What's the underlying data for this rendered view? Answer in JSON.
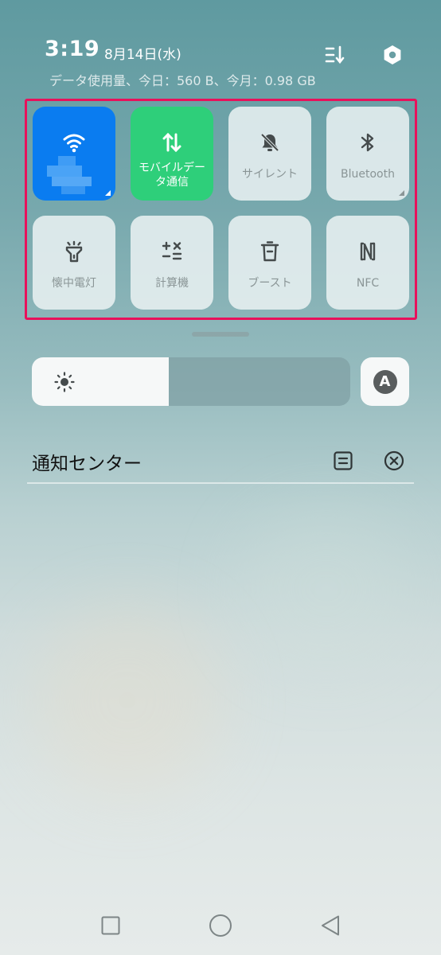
{
  "status": {
    "time": "3:19",
    "date": "8月14日(水)",
    "data_usage": "データ使用量、今日：560 B、今月：0.98 GB"
  },
  "header_icons": [
    "edit-tiles-icon",
    "settings-icon"
  ],
  "tiles": [
    {
      "id": "wifi",
      "label": "",
      "icon": "wifi-icon",
      "active": true,
      "color": "#0a7cf0"
    },
    {
      "id": "mobile-data",
      "label": "モバイルデータ通信",
      "icon": "data-transfer-icon",
      "active": true,
      "color": "#2ecf7a"
    },
    {
      "id": "silent",
      "label": "サイレント",
      "icon": "bell-off-icon",
      "active": false
    },
    {
      "id": "bluetooth",
      "label": "Bluetooth",
      "icon": "bluetooth-icon",
      "active": false
    },
    {
      "id": "flashlight",
      "label": "懐中電灯",
      "icon": "flashlight-icon",
      "active": false
    },
    {
      "id": "calculator",
      "label": "計算機",
      "icon": "calculator-icon",
      "active": false
    },
    {
      "id": "boost",
      "label": "ブースト",
      "icon": "trash-icon",
      "active": false
    },
    {
      "id": "nfc",
      "label": "NFC",
      "icon": "nfc-icon",
      "active": false
    }
  ],
  "brightness": {
    "level": 0.43,
    "auto_label": "A"
  },
  "notifications": {
    "title": "通知センター"
  },
  "colors": {
    "highlight_border": "#e8115b",
    "wifi_active": "#0a7cf0",
    "mobile_active": "#2ecf7a"
  }
}
